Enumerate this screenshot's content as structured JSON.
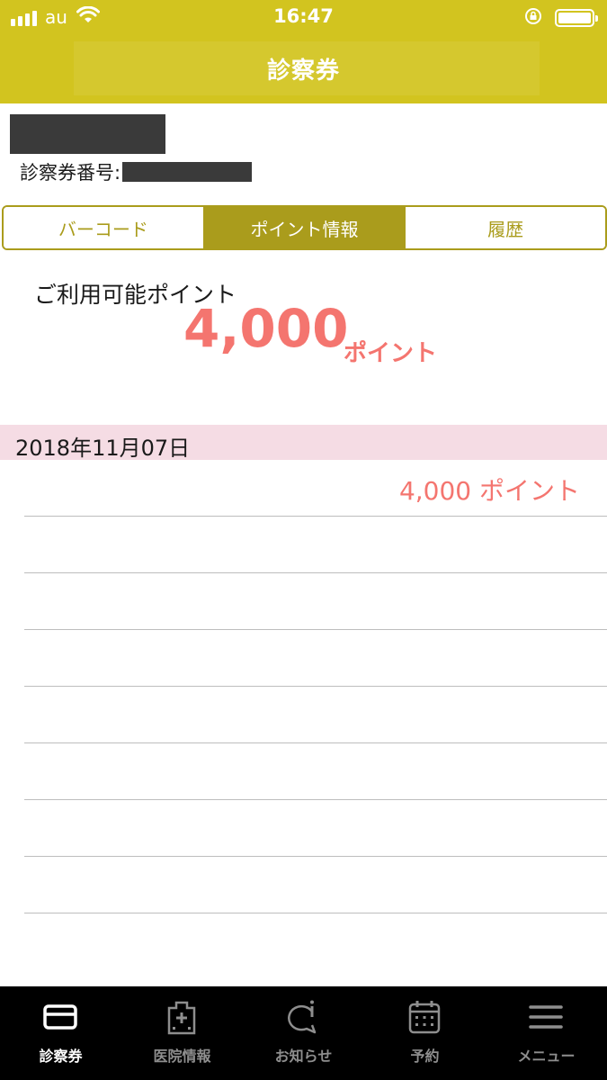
{
  "status_bar": {
    "carrier": "au",
    "time": "16:47"
  },
  "nav": {
    "title": "診察券"
  },
  "patient": {
    "ticket_label": "診察券番号:"
  },
  "tabs": [
    {
      "label": "バーコード",
      "active": false
    },
    {
      "label": "ポイント情報",
      "active": true
    },
    {
      "label": "履歴",
      "active": false
    }
  ],
  "points": {
    "label": "ご利用可能ポイント",
    "value": "4,000",
    "unit": "ポイント"
  },
  "history": {
    "date": "2018年11月07日",
    "amount": "4,000 ポイント"
  },
  "tabbar": [
    {
      "label": "診察券",
      "icon": "card-icon",
      "active": true
    },
    {
      "label": "医院情報",
      "icon": "clinic-icon",
      "active": false
    },
    {
      "label": "お知らせ",
      "icon": "notice-icon",
      "active": false
    },
    {
      "label": "予約",
      "icon": "calendar-icon",
      "active": false
    },
    {
      "label": "メニュー",
      "icon": "menu-icon",
      "active": false
    }
  ],
  "colors": {
    "brand": "#d2c41f",
    "tab_accent": "#aa9c1c",
    "points": "#f4756f",
    "date_bg": "#f5dce4"
  }
}
